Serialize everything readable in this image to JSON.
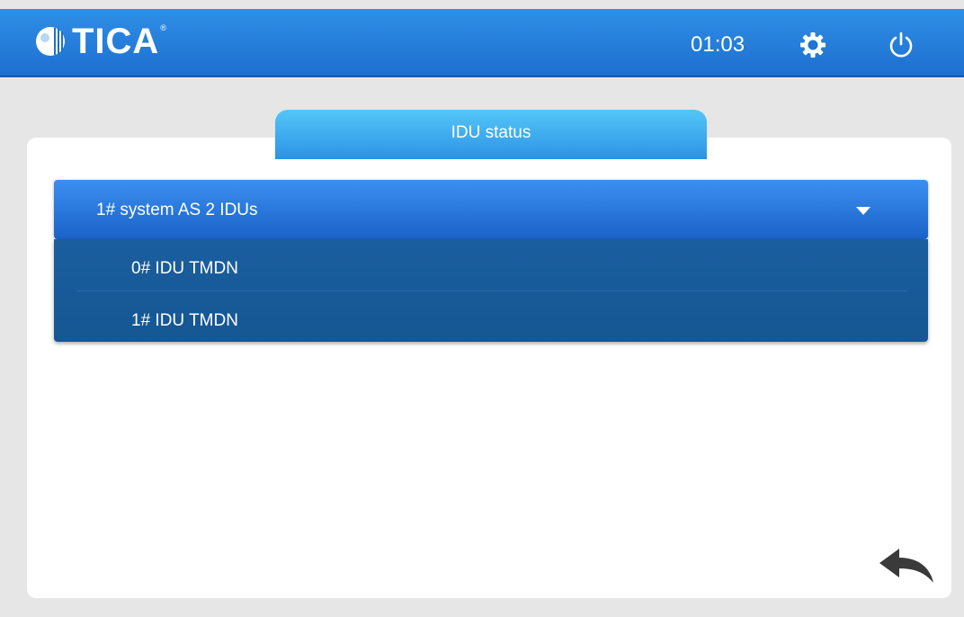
{
  "header": {
    "logo_text": "TICA",
    "logo_registered": "®",
    "time": "01:03",
    "settings_icon": "gear-icon",
    "power_icon": "power-icon",
    "colors": {
      "bar": "#1f74d6"
    }
  },
  "tab": {
    "title": "IDU status"
  },
  "system_select": {
    "selected": "1# system AS 2 IDUs",
    "options": [
      {
        "label": "0# IDU TMDN"
      },
      {
        "label": "1# IDU TMDN"
      }
    ]
  },
  "footer": {
    "back_icon": "back-arrow-icon"
  }
}
